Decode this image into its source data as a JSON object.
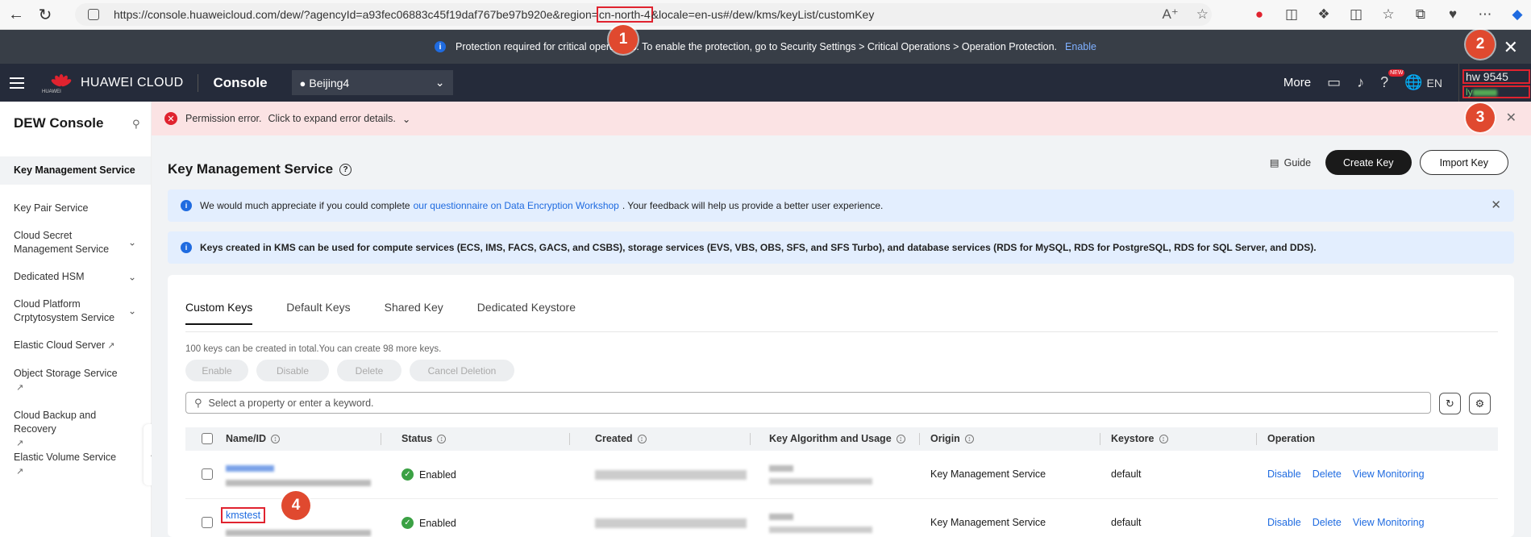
{
  "browser": {
    "url_prefix": "https://console.huaweicloud.com/dew/?agencyId=a93fec06883c45f19daf767be97b920e&region=",
    "url_region": "cn-north-4",
    "url_suffix": "&locale=en-us#/dew/kms/keyList/customKey"
  },
  "notice": {
    "text": "Protection required for critical operations. To enable the protection, go to Security Settings > Critical Operations > Operation Protection.",
    "enable_label": "Enable"
  },
  "topnav": {
    "brand": "HUAWEI CLOUD",
    "brand_sub": "HUAWEI",
    "console_label": "Console",
    "region": "Beijing4",
    "more_label": "More",
    "new_badge": "NEW",
    "lang": "EN",
    "account_name": "hw        9545",
    "account_sub": "ly"
  },
  "sidebar": {
    "title": "DEW Console",
    "items": [
      {
        "label": "Key Management Service"
      },
      {
        "label": "Key Pair Service"
      },
      {
        "label": "Cloud Secret Management Service"
      },
      {
        "label": "Dedicated HSM"
      },
      {
        "label": "Cloud Platform Crptytosystem Service"
      },
      {
        "label": "Elastic Cloud Server"
      },
      {
        "label": "Object Storage Service"
      },
      {
        "label": "Cloud Backup and Recovery"
      },
      {
        "label": "Elastic Volume Service"
      }
    ]
  },
  "error": {
    "text": "Permission error.",
    "detail": "Click to expand error details."
  },
  "page": {
    "title": "Key Management Service",
    "guide_label": "Guide",
    "create_label": "Create Key",
    "import_label": "Import Key"
  },
  "banner1": {
    "pre": "We would much appreciate if you could complete",
    "link": "our questionnaire on Data Encryption Workshop",
    "post": ". Your feedback will help us provide a better user experience."
  },
  "banner2": {
    "text": "Keys created in KMS can be used for compute services (ECS, IMS, FACS, GACS, and CSBS), storage services (EVS, VBS, OBS, SFS, and SFS Turbo), and database services (RDS for MySQL, RDS for PostgreSQL, RDS for SQL Server, and DDS)."
  },
  "tabs": [
    "Custom Keys",
    "Default Keys",
    "Shared Key",
    "Dedicated Keystore"
  ],
  "quota_text": "100 keys can be created in total.You can create 98 more keys.",
  "bulk_actions": [
    "Enable",
    "Disable",
    "Delete",
    "Cancel Deletion"
  ],
  "search_placeholder": "Select a property or enter a keyword.",
  "table": {
    "columns": [
      "Name/ID",
      "Status",
      "Created",
      "Key Algorithm and Usage",
      "Origin",
      "Keystore",
      "Operation"
    ],
    "rows": [
      {
        "name": "",
        "status": "Enabled",
        "origin": "Key Management Service",
        "keystore": "default",
        "ops": [
          "Disable",
          "Delete",
          "View Monitoring"
        ]
      },
      {
        "name": "kmstest",
        "status": "Enabled",
        "origin": "Key Management Service",
        "keystore": "default",
        "ops": [
          "Disable",
          "Delete",
          "View Monitoring"
        ]
      }
    ]
  },
  "markers": [
    "1",
    "2",
    "3",
    "4"
  ]
}
